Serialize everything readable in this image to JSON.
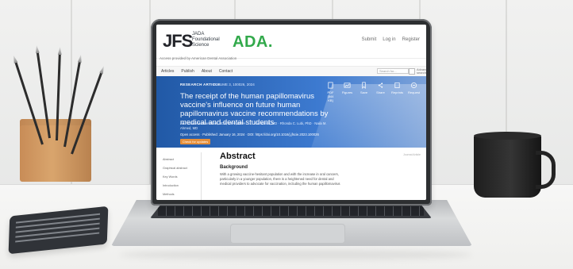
{
  "site": {
    "journal_logo": "JFS",
    "journal_subtitle": [
      "JADA",
      "Foundational",
      "Science"
    ],
    "ada_logo": "ADA.",
    "top_links": [
      "Submit",
      "Log in",
      "Register"
    ],
    "access_note": "Access provided by American Dental Association"
  },
  "menu": {
    "items": [
      "Articles",
      "Publish",
      "About",
      "Contact"
    ],
    "search_placeholder": "Search for...",
    "advanced_search": "Advanced search"
  },
  "article": {
    "tag": "RESEARCH ARTICLE",
    "volume": "VOLUME 3, 100026, 2024",
    "title": "The receipt of the human papillomavirus vaccine's influence on future human papillomavirus vaccine recommendations by medical and dental students",
    "authors": "Ana Karina Mascarenhas, BDS, MPH, DrPH · ... · Ana Kamal, MD · Rhonda C. Lubi, PhD · Naila M. Ahmed, MD",
    "published": "Open access · Published: January 16, 2024 · DOI: https://doi.org/10.1016/j.jfscie.2023.100026",
    "check_updates": "Check for updates",
    "tools": [
      "PDF [544 KB]",
      "Figures",
      "Save",
      "Share",
      "Reprints",
      "Request"
    ]
  },
  "sidebar": {
    "items": [
      "Abstract",
      "Graphical abstract",
      "Key Words",
      "Introduction",
      "Methods"
    ]
  },
  "content": {
    "abstract_heading": "Abstract",
    "background_heading": "Background",
    "abstract_text": "With a growing vaccine-hesitant population and with the increase in oral cancers, particularly in a younger population, there is a heightened need for dental and medical providers to advocate for vaccination, including the human papillomavirus",
    "right_note": "Journal Article"
  }
}
